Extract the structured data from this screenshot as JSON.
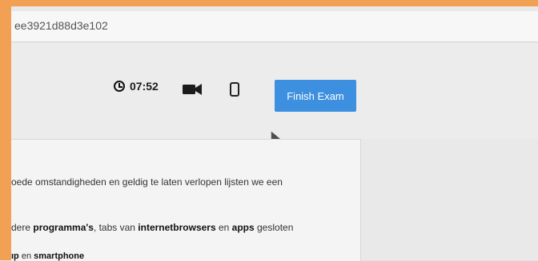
{
  "browser": {
    "url": "ee3921d88d3e102"
  },
  "exam": {
    "timer": "07:52",
    "finish_label": "Finish Exam"
  },
  "content": {
    "line1": "oede omstandigheden en geldig te laten verlopen lijsten we een",
    "line2_prefix": "dere ",
    "line2_bold1": "programma's",
    "line2_mid1": ", tabs van ",
    "line2_bold2": "internetbrowsers",
    "line2_mid2": " en ",
    "line2_bold3": "apps",
    "line2_suffix": " gesloten",
    "line3_bold1": "ıp",
    "line3_mid": " en ",
    "line3_bold2": "smartphone"
  },
  "icons": {
    "timer_icon": "clock-icon",
    "camera_icon": "video-camera-icon",
    "device_icon": "smartphone-icon"
  },
  "colors": {
    "accent_button": "#3d8fdf",
    "frame_border": "#f2a154"
  }
}
